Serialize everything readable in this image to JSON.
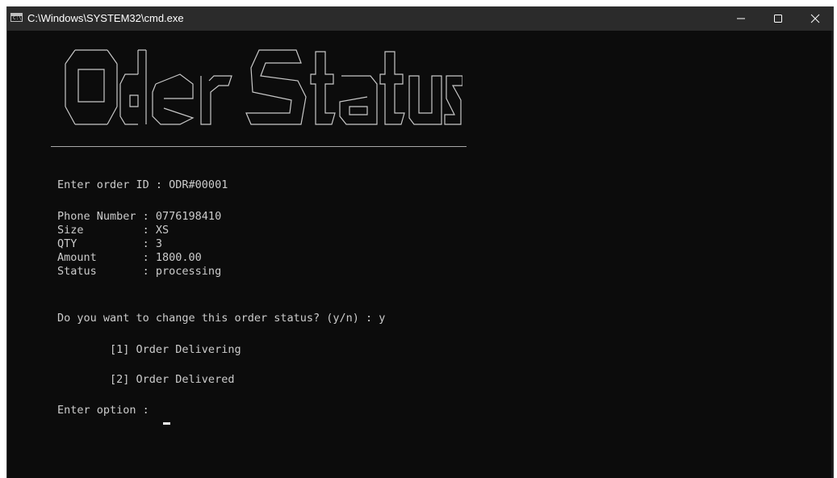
{
  "window": {
    "title": "C:\\Windows\\SYSTEM32\\cmd.exe",
    "app_icon_text": "C:\\",
    "controls": [
      "minimize-icon",
      "maximize-icon",
      "close-icon"
    ]
  },
  "banner": {
    "text": "Oder Status",
    "style": "ascii-art"
  },
  "terminal": {
    "order_prompt": "Enter order ID : ODR#00001",
    "phone": "Phone Number : 0776198410",
    "size": "Size         : XS",
    "qty": "QTY          : 3",
    "amount": "Amount       : 1800.00",
    "status": "Status       : processing",
    "change_prompt": "Do you want to change this order status? (y/n) : y",
    "option1": "        [1] Order Delivering",
    "option2": "        [2] Order Delivered",
    "option_prompt": "Enter option : "
  },
  "colors": {
    "background": "#0c0c0c",
    "text": "#cccccc",
    "titlebar": "#2b2b2b"
  }
}
